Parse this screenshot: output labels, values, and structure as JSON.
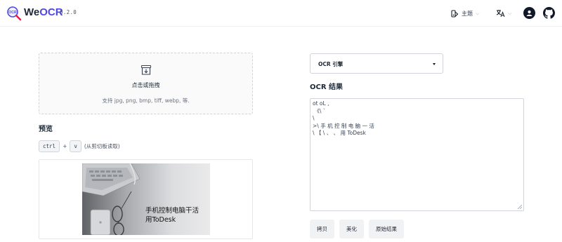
{
  "header": {
    "brand_prefix": "We",
    "brand_accent": "OCR",
    "version": "0.2.0",
    "theme_label": "主题",
    "icons": {
      "logo": "ocr-magnifier-logo-icon",
      "theme": "palette-icon",
      "language": "translate-icon",
      "user": "user-avatar-icon",
      "github": "github-icon"
    }
  },
  "upload": {
    "icon": "download-box-icon",
    "title": "点击或拖拽",
    "hint": "支持 jpg, png, bmp, tiff, webp, 等."
  },
  "preview": {
    "title": "预览",
    "shortcut_key1": "ctrl",
    "shortcut_plus": "+",
    "shortcut_key2": "v",
    "shortcut_note": "(从剪切板读取)",
    "image_text_line1": "手机控制电脑干活",
    "image_text_line2": "用ToDesk"
  },
  "engine": {
    "selected": "OCR 引擎"
  },
  "result": {
    "title": "OCR 结果",
    "lines": [
      "ot oL ,",
      " 《\\ `",
      "\\",
      ">\\ 手 机 控 制 电 脑 一 活",
      "\\ 【 \\ 、 、 用 ToDesk"
    ]
  },
  "actions": {
    "copy": "拷贝",
    "beautify": "美化",
    "raw": "原始结果"
  },
  "colors": {
    "accent": "#4f46e5",
    "text": "#1f2937",
    "button_bg": "#f1f2f4",
    "border": "#d1d5db"
  }
}
